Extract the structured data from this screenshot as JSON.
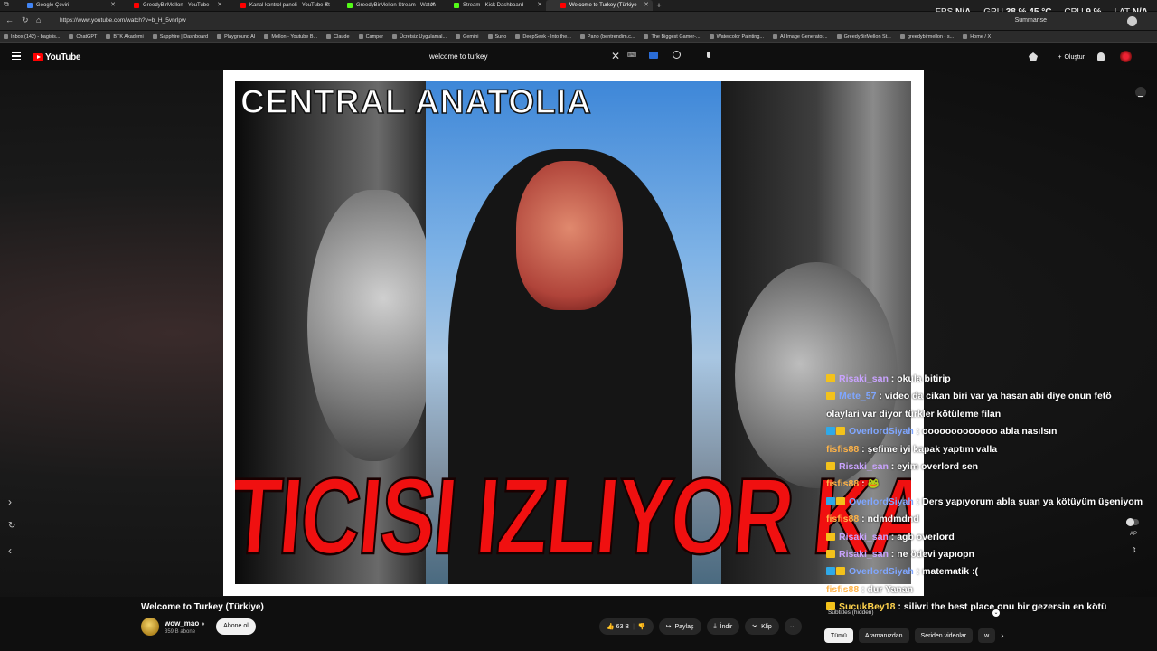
{
  "browser": {
    "tabs": [
      {
        "label": "Google Çeviri",
        "color": "#4285f4"
      },
      {
        "label": "GreedyBirMellon - YouTube",
        "color": "#ff0000"
      },
      {
        "label": "Kanal kontrol paneli - YouTube St",
        "color": "#ff0000"
      },
      {
        "label": "GreedyBirMellon Stream - Watch",
        "color": "#53fc18"
      },
      {
        "label": "Stream - Kick Dashboard",
        "color": "#53fc18"
      },
      {
        "label": "Welcome to Turkey (Türkiye",
        "color": "#ff0000"
      }
    ],
    "new_tab": "+",
    "url": "https://www.youtube.com/watch?v=b_H_5vnrlpw",
    "summarise_label": "Summarise",
    "bookmarks": [
      "Inbox (142) - bagisis...",
      "ChatGPT",
      "BTK Akademi",
      "Sapphire | Dashboard",
      "Playground AI",
      "Mellon - Youtube B...",
      "Claude",
      "Camper",
      "Ücretsiz Uygulamal...",
      "Gemini",
      "Suno",
      "DeepSeek - Into the...",
      "Pano (bentrendim.c...",
      "The Biggest Gamer-...",
      "Watercolor Painting...",
      "AI Image Generator...",
      "GreedyBirMellon St...",
      "greedybirmellon - s...",
      "Home / X"
    ]
  },
  "hud": {
    "fps_label": "FPS",
    "fps_value": "N/A",
    "gpu_label": "GPU",
    "gpu_value": "38 % 45 °C",
    "cpu_label": "CPU",
    "cpu_value": "9 %",
    "lat_label": "LAT",
    "lat_value": "N/A"
  },
  "youtube": {
    "logo_text": "YouTube",
    "search_query": "welcome to turkey",
    "create_label": "Oluştur"
  },
  "video": {
    "overlay_title": "CENTRAL ANATOLIA",
    "overlay_red": "TICISI IZLIYOR  KAR"
  },
  "chat": [
    {
      "user": "Risaki_san",
      "color": "#c9a3ff",
      "badges": [
        "gold"
      ],
      "text": ": okula bitirip"
    },
    {
      "user": "Mete_57",
      "color": "#7fa6ff",
      "badges": [
        "gold"
      ],
      "text": ": video da cikan biri var ya hasan abi diye onun fetö"
    },
    {
      "user": "",
      "color": "#fff",
      "badges": [],
      "text": "olaylari var diyor türkler kötüleme filan"
    },
    {
      "user": "OverlordSiyah",
      "color": "#7fa6ff",
      "badges": [
        "blue",
        "gold"
      ],
      "text": ": ooooooooooooo abla nasılsın"
    },
    {
      "user": "fisfis88",
      "color": "#ffb347",
      "badges": [],
      "text": ": şefime iyi kapak yaptım valla"
    },
    {
      "user": "Risaki_san",
      "color": "#c9a3ff",
      "badges": [
        "gold"
      ],
      "text": ": eyim overlord sen"
    },
    {
      "user": "fisfis88",
      "color": "#ffb347",
      "badges": [],
      "text": ": 🐸"
    },
    {
      "user": "OverlordSiyah",
      "color": "#7fa6ff",
      "badges": [
        "blue",
        "gold"
      ],
      "text": ": Ders yapıyorum abla şuan ya kötüyüm üşeniyom"
    },
    {
      "user": "fisfis88",
      "color": "#ffb347",
      "badges": [],
      "text": ": ndmdmdnd"
    },
    {
      "user": "Risaki_san",
      "color": "#c9a3ff",
      "badges": [
        "gold"
      ],
      "text": ": agb overlord"
    },
    {
      "user": "Risaki_san",
      "color": "#c9a3ff",
      "badges": [
        "gold"
      ],
      "text": ": ne ödevi yapıopn"
    },
    {
      "user": "OverlordSiyah",
      "color": "#7fa6ff",
      "badges": [
        "blue",
        "gold"
      ],
      "text": ": matematik :("
    },
    {
      "user": "fisfis88",
      "color": "#ffb347",
      "badges": [],
      "text": ": dur Yanan"
    },
    {
      "user": "SucukBey18",
      "color": "#ffd34d",
      "badges": [
        "gold"
      ],
      "text": ": silivri the best place onu bir gezersin en kötü"
    }
  ],
  "player_controls": {
    "autoplay_label": "AP"
  },
  "watch": {
    "title": "Welcome to Turkey (Türkiye)",
    "channel": "wow_mao",
    "subscribers": "359 B abone",
    "subscribe_label": "Abone ol",
    "likes": "63 B",
    "share_label": "Paylaş",
    "download_label": "İndir",
    "clip_label": "Klip",
    "more_label": "···",
    "subtitles_label": "Subtitles (hidden)",
    "chips": [
      "Tümü",
      "Aramanızdan",
      "Seriden videolar",
      "w"
    ]
  }
}
